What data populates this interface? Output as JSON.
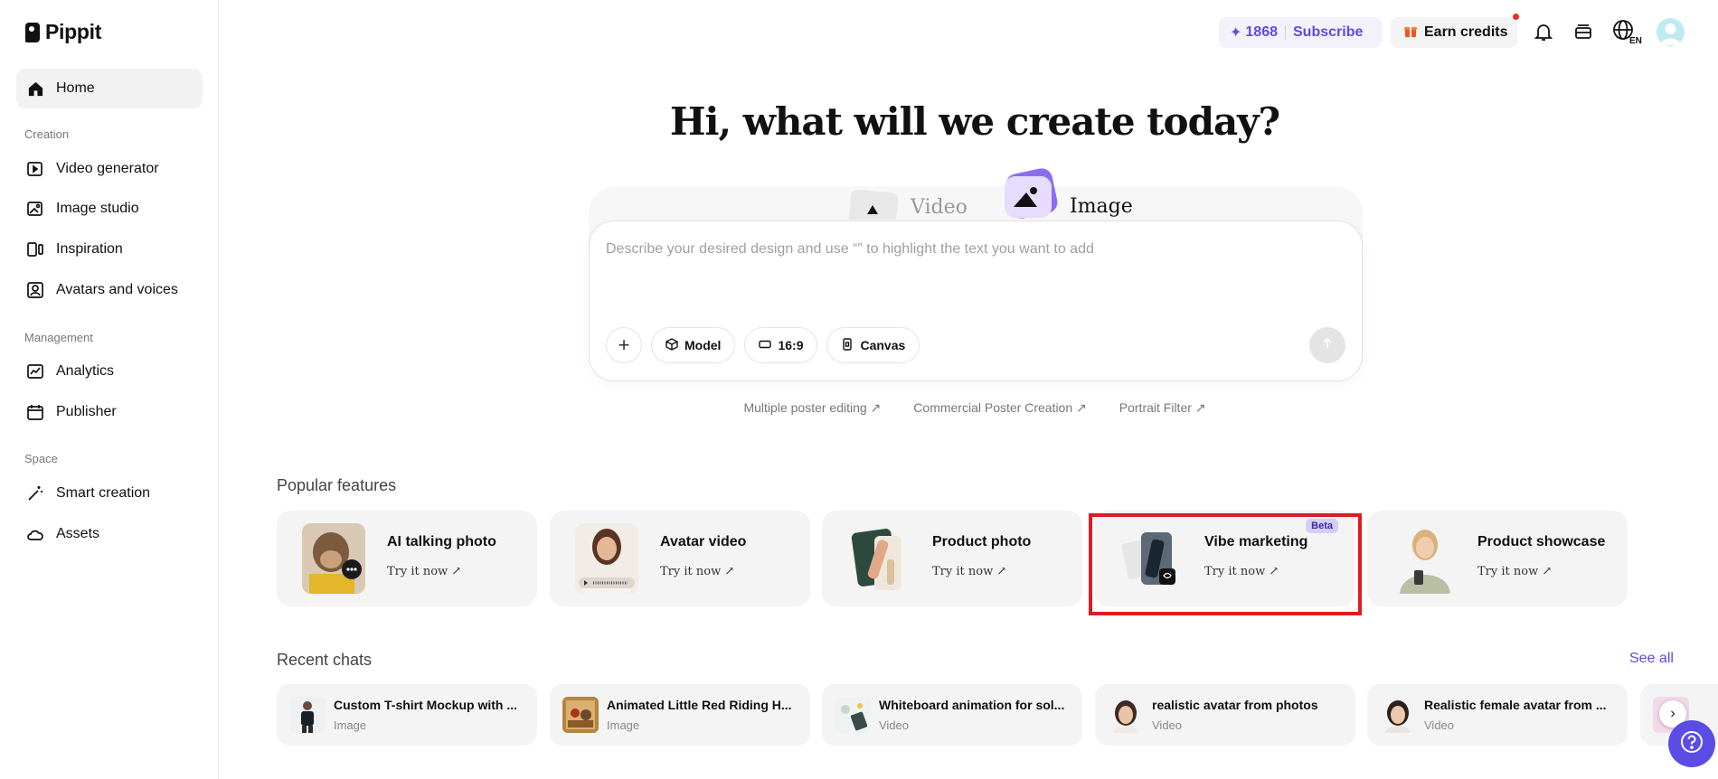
{
  "brand": {
    "name": "Pippit"
  },
  "sidebar": {
    "home": "Home",
    "sections": [
      {
        "title": "Creation",
        "items": [
          "Video generator",
          "Image studio",
          "Inspiration",
          "Avatars and voices"
        ]
      },
      {
        "title": "Management",
        "items": [
          "Analytics",
          "Publisher"
        ]
      },
      {
        "title": "Space",
        "items": [
          "Smart creation",
          "Assets"
        ]
      }
    ]
  },
  "topbar": {
    "credits": "1868",
    "subscribe": "Subscribe",
    "earn_credits": "Earn credits",
    "language": "EN"
  },
  "hero": {
    "title": "Hi, what will we create today?",
    "tabs": {
      "video": "Video",
      "image": "Image",
      "active": "Image"
    },
    "prompt_placeholder": "Describe your desired design and use “” to highlight the text you want to add",
    "tools": {
      "model": "Model",
      "ratio": "16:9",
      "canvas": "Canvas"
    },
    "suggestions": [
      "Multiple poster editing ↗",
      "Commercial Poster Creation ↗",
      "Portrait Filter ↗"
    ]
  },
  "popular": {
    "title": "Popular features",
    "cards": [
      {
        "name": "AI talking photo",
        "cta": "Try it now ↗"
      },
      {
        "name": "Avatar video",
        "cta": "Try it now ↗"
      },
      {
        "name": "Product photo",
        "cta": "Try it now ↗"
      },
      {
        "name": "Vibe marketing",
        "cta": "Try it now ↗",
        "badge": "Beta"
      },
      {
        "name": "Product showcase",
        "cta": "Try it now ↗"
      }
    ]
  },
  "recent": {
    "title": "Recent chats",
    "see_all": "See all",
    "chats": [
      {
        "title": "Custom T-shirt Mockup with ...",
        "type": "Image"
      },
      {
        "title": "Animated Little Red Riding H...",
        "type": "Image"
      },
      {
        "title": "Whiteboard animation for sol...",
        "type": "Video"
      },
      {
        "title": "realistic avatar from photos",
        "type": "Video"
      },
      {
        "title": "Realistic female avatar from ...",
        "type": "Video"
      }
    ]
  },
  "colors": {
    "accent": "#5b4ce6",
    "highlight": "#e01b22",
    "card_bg": "#f4f4f4"
  }
}
